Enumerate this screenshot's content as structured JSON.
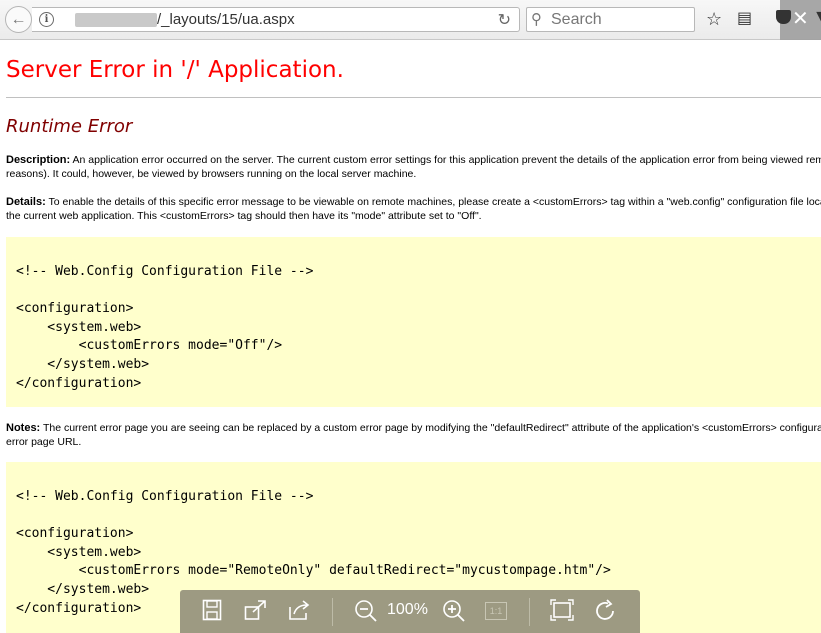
{
  "browser": {
    "url_path": "/_layouts/15/ua.aspx",
    "search_placeholder": "Search",
    "icons": {
      "back": "back-arrow-icon",
      "info": "info-icon",
      "reload": "reload-icon",
      "search": "search-icon",
      "bookmark": "star-icon",
      "reader": "reader-view-icon",
      "pocket": "pocket-icon",
      "close": "close-icon"
    }
  },
  "page": {
    "title": "Server Error in '/' Application.",
    "subtitle": "Runtime Error",
    "description": {
      "label": "Description:",
      "line1": " An application error occurred on the server. The current custom error settings for this application prevent the details of the application error from being viewed remotely (for security",
      "line2": "reasons). It could, however, be viewed by browsers running on the local server machine."
    },
    "details": {
      "label": "Details:",
      "line1": " To enable the details of this specific error message to be viewable on remote machines, please create a <customErrors> tag within a \"web.config\" configuration file located in the root directory of",
      "line2": "the current web application. This <customErrors> tag should then have its \"mode\" attribute set to \"Off\"."
    },
    "code1": "<!-- Web.Config Configuration File -->\n\n<configuration>\n    <system.web>\n        <customErrors mode=\"Off\"/>\n    </system.web>\n</configuration>",
    "notes": {
      "label": "Notes:",
      "line1": " The current error page you are seeing can be replaced by a custom error page by modifying the \"defaultRedirect\" attribute of the application's <customErrors> configuration tag to point to a custom",
      "line2": "error page URL."
    },
    "code2": "<!-- Web.Config Configuration File -->\n\n<configuration>\n    <system.web>\n        <customErrors mode=\"RemoteOnly\" defaultRedirect=\"mycustompage.htm\"/>\n    </system.web>\n</configuration>"
  },
  "viewer": {
    "zoom": "100%",
    "one_to_one": "1:1",
    "icons": [
      "save-icon",
      "open-external-icon",
      "share-icon",
      "zoom-out-icon",
      "zoom-in-icon",
      "actual-size-icon",
      "fit-to-screen-icon",
      "rotate-icon"
    ]
  }
}
